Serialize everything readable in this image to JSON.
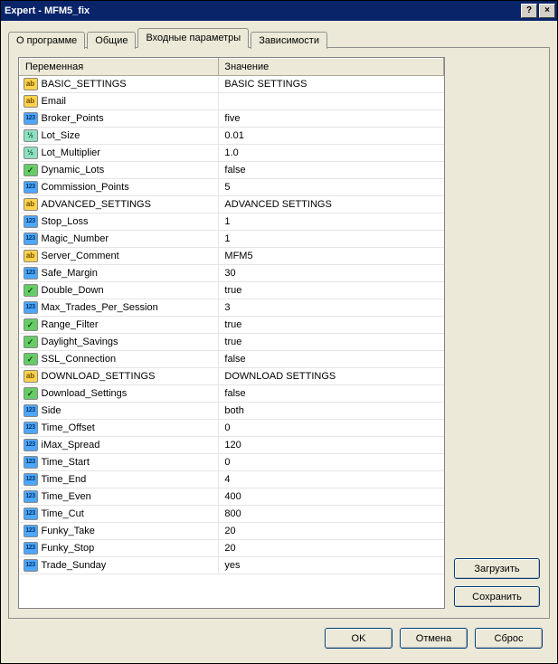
{
  "window": {
    "title": "Expert - MFM5_fix",
    "help_btn": "?",
    "close_btn": "×"
  },
  "tabs": [
    {
      "id": "about",
      "label": "О программе",
      "active": false
    },
    {
      "id": "common",
      "label": "Общие",
      "active": false
    },
    {
      "id": "inputs",
      "label": "Входные параметры",
      "active": true
    },
    {
      "id": "deps",
      "label": "Зависимости",
      "active": false
    }
  ],
  "grid": {
    "col_variable": "Переменная",
    "col_value": "Значение",
    "rows": [
      {
        "type": "ab",
        "name": "BASIC_SETTINGS",
        "value": "BASIC SETTINGS"
      },
      {
        "type": "ab",
        "name": "Email",
        "value": ""
      },
      {
        "type": "123",
        "name": "Broker_Points",
        "value": "five"
      },
      {
        "type": "v2",
        "name": "Lot_Size",
        "value": "0.01"
      },
      {
        "type": "v2",
        "name": "Lot_Multiplier",
        "value": "1.0"
      },
      {
        "type": "bool",
        "name": "Dynamic_Lots",
        "value": "false"
      },
      {
        "type": "123",
        "name": "Commission_Points",
        "value": "5"
      },
      {
        "type": "ab",
        "name": "ADVANCED_SETTINGS",
        "value": "ADVANCED SETTINGS"
      },
      {
        "type": "123",
        "name": "Stop_Loss",
        "value": "1"
      },
      {
        "type": "123",
        "name": "Magic_Number",
        "value": "1"
      },
      {
        "type": "ab",
        "name": "Server_Comment",
        "value": "MFM5"
      },
      {
        "type": "123",
        "name": "Safe_Margin",
        "value": "30"
      },
      {
        "type": "bool",
        "name": "Double_Down",
        "value": "true"
      },
      {
        "type": "123",
        "name": "Max_Trades_Per_Session",
        "value": "3"
      },
      {
        "type": "bool",
        "name": "Range_Filter",
        "value": "true"
      },
      {
        "type": "bool",
        "name": "Daylight_Savings",
        "value": "true"
      },
      {
        "type": "bool",
        "name": "SSL_Connection",
        "value": "false"
      },
      {
        "type": "ab",
        "name": "DOWNLOAD_SETTINGS",
        "value": "DOWNLOAD SETTINGS"
      },
      {
        "type": "bool",
        "name": "Download_Settings",
        "value": "false"
      },
      {
        "type": "123",
        "name": "Side",
        "value": "both"
      },
      {
        "type": "123",
        "name": "Time_Offset",
        "value": "0"
      },
      {
        "type": "123",
        "name": "iMax_Spread",
        "value": "120"
      },
      {
        "type": "123",
        "name": "Time_Start",
        "value": "0"
      },
      {
        "type": "123",
        "name": "Time_End",
        "value": "4"
      },
      {
        "type": "123",
        "name": "Time_Even",
        "value": "400"
      },
      {
        "type": "123",
        "name": "Time_Cut",
        "value": "800"
      },
      {
        "type": "123",
        "name": "Funky_Take",
        "value": "20"
      },
      {
        "type": "123",
        "name": "Funky_Stop",
        "value": "20"
      },
      {
        "type": "123",
        "name": "Trade_Sunday",
        "value": "yes"
      }
    ]
  },
  "side_buttons": {
    "load": "Загрузить",
    "save": "Сохранить"
  },
  "bottom_buttons": {
    "ok": "OK",
    "cancel": "Отмена",
    "reset": "Сброс"
  },
  "type_labels": {
    "ab": "ab",
    "123": "123",
    "v2": "½",
    "bool": "✓"
  }
}
